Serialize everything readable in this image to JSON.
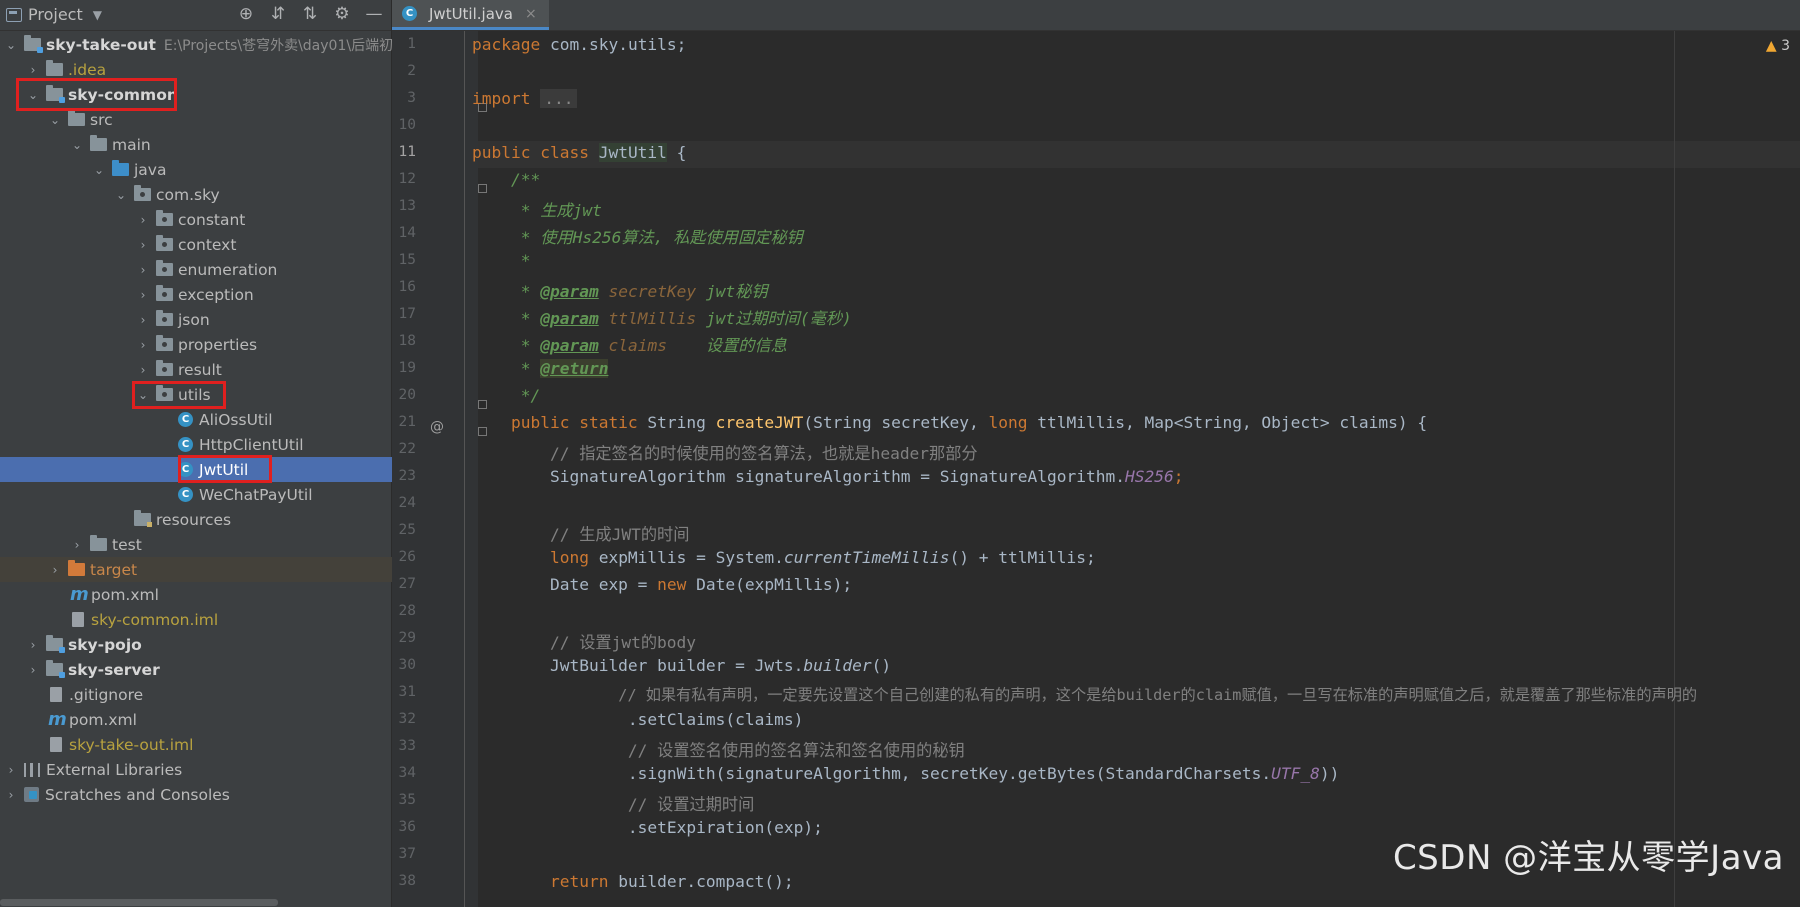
{
  "project_panel": {
    "title": "Project",
    "tree": [
      {
        "label": "sky-take-out",
        "path": "E:\\Projects\\苍穹外卖\\day01\\后端初",
        "bold": true
      },
      {
        "label": ".idea"
      },
      {
        "label": "sky-common",
        "bold": true
      },
      {
        "label": "src"
      },
      {
        "label": "main"
      },
      {
        "label": "java"
      },
      {
        "label": "com.sky"
      },
      {
        "label": "constant"
      },
      {
        "label": "context"
      },
      {
        "label": "enumeration"
      },
      {
        "label": "exception"
      },
      {
        "label": "json"
      },
      {
        "label": "properties"
      },
      {
        "label": "result"
      },
      {
        "label": "utils"
      },
      {
        "label": "AliOssUtil"
      },
      {
        "label": "HttpClientUtil"
      },
      {
        "label": "JwtUtil"
      },
      {
        "label": "WeChatPayUtil"
      },
      {
        "label": "resources"
      },
      {
        "label": "test"
      },
      {
        "label": "target"
      },
      {
        "label": "pom.xml"
      },
      {
        "label": "sky-common.iml"
      },
      {
        "label": "sky-pojo",
        "bold": true
      },
      {
        "label": "sky-server",
        "bold": true
      },
      {
        "label": ".gitignore"
      },
      {
        "label": "pom.xml"
      },
      {
        "label": "sky-take-out.iml"
      },
      {
        "label": "External Libraries"
      },
      {
        "label": "Scratches and Consoles"
      }
    ]
  },
  "editor": {
    "tab_label": "JwtUtil.java",
    "warning_count": "3",
    "line_numbers": [
      "1",
      "2",
      "3",
      "10",
      "11",
      "12",
      "13",
      "14",
      "15",
      "16",
      "17",
      "18",
      "19",
      "20",
      "21",
      "22",
      "23",
      "24",
      "25",
      "26",
      "27",
      "28",
      "29",
      "30",
      "31",
      "32",
      "33",
      "34",
      "35",
      "36",
      "37",
      "38"
    ],
    "code": {
      "l1_kw": "package",
      "l1_rest": " com.sky.utils;",
      "l3_kw": "import",
      "l3_fold": "...",
      "l11_kw": "public class",
      "l11_cls": "JwtUtil",
      "l11_rest": " {",
      "l12": "    /**",
      "l13": "     * 生成jwt",
      "l14": "     * 使用Hs256算法, 私匙使用固定秘钥",
      "l15": "     *",
      "l16_pre": "     * ",
      "l16_tag": "@param",
      "l16_name": " secretKey",
      "l16_desc": " jwt秘钥",
      "l17_pre": "     * ",
      "l17_tag": "@param",
      "l17_name": " ttlMillis",
      "l17_desc": " jwt过期时间(毫秒)",
      "l18_pre": "     * ",
      "l18_tag": "@param",
      "l18_name": " claims",
      "l18_desc": "    设置的信息",
      "l19_pre": "     * ",
      "l19_tag": "@return",
      "l20": "     */",
      "l21_kw1": "    public static",
      "l21_t1": " String ",
      "l21_fn": "createJWT",
      "l21_p1": "(String secretKey, ",
      "l21_kw2": "long",
      "l21_p2": " ttlMillis, Map<String, Object> claims) {",
      "l22": "        // 指定签名的时候使用的签名算法，也就是header那部分",
      "l23_a": "        SignatureAlgorithm signatureAlgorithm = SignatureAlgorithm.",
      "l23_f": "HS256",
      "l23_b": ";",
      "l25": "        // 生成JWT的时间",
      "l26_kw": "        long",
      "l26_a": " expMillis = System.",
      "l26_m": "currentTimeMillis",
      "l26_b": "() + ttlMillis;",
      "l27_a": "        Date exp = ",
      "l27_kw": "new",
      "l27_b": " Date(expMillis);",
      "l29": "        // 设置jwt的body",
      "l30_a": "        JwtBuilder builder = Jwts.",
      "l30_m": "builder",
      "l30_b": "()",
      "l31": "                // 如果有私有声明，一定要先设置这个自己创建的私有的声明，这个是给builder的claim赋值，一旦写在标准的声明赋值之后，就是覆盖了那些标准的声明的",
      "l32": "                .setClaims(claims)",
      "l33": "                // 设置签名使用的签名算法和签名使用的秘钥",
      "l34_a": "                .signWith(signatureAlgorithm, secretKey.getBytes(StandardCharsets.",
      "l34_f": "UTF_8",
      "l34_b": "))",
      "l35": "                // 设置过期时间",
      "l36": "                .setExpiration(exp);",
      "l38_kw": "        return",
      "l38_b": " builder.compact();"
    }
  },
  "watermark": "CSDN @洋宝从零学Java"
}
